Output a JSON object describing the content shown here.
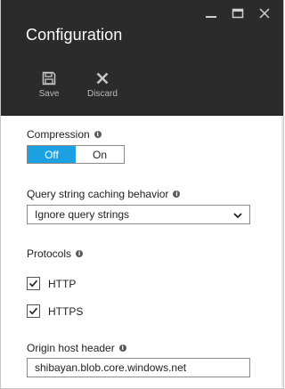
{
  "window": {
    "controls": [
      "minimize",
      "maximize",
      "close"
    ]
  },
  "header": {
    "title": "Configuration",
    "commands": [
      {
        "label": "Save",
        "icon": "save-icon"
      },
      {
        "label": "Discard",
        "icon": "discard-icon"
      }
    ],
    "background": "#2b2b2b"
  },
  "compression": {
    "label": "Compression",
    "options": [
      "Off",
      "On"
    ],
    "selected": "Off",
    "accent": "#1ba1e2"
  },
  "query_caching": {
    "label": "Query string caching behavior",
    "value": "Ignore query strings"
  },
  "protocols": {
    "label": "Protocols",
    "items": [
      {
        "label": "HTTP",
        "checked": true
      },
      {
        "label": "HTTPS",
        "checked": true
      }
    ]
  },
  "origin_host": {
    "label": "Origin host header",
    "value": "shibayan.blob.core.windows.net"
  }
}
